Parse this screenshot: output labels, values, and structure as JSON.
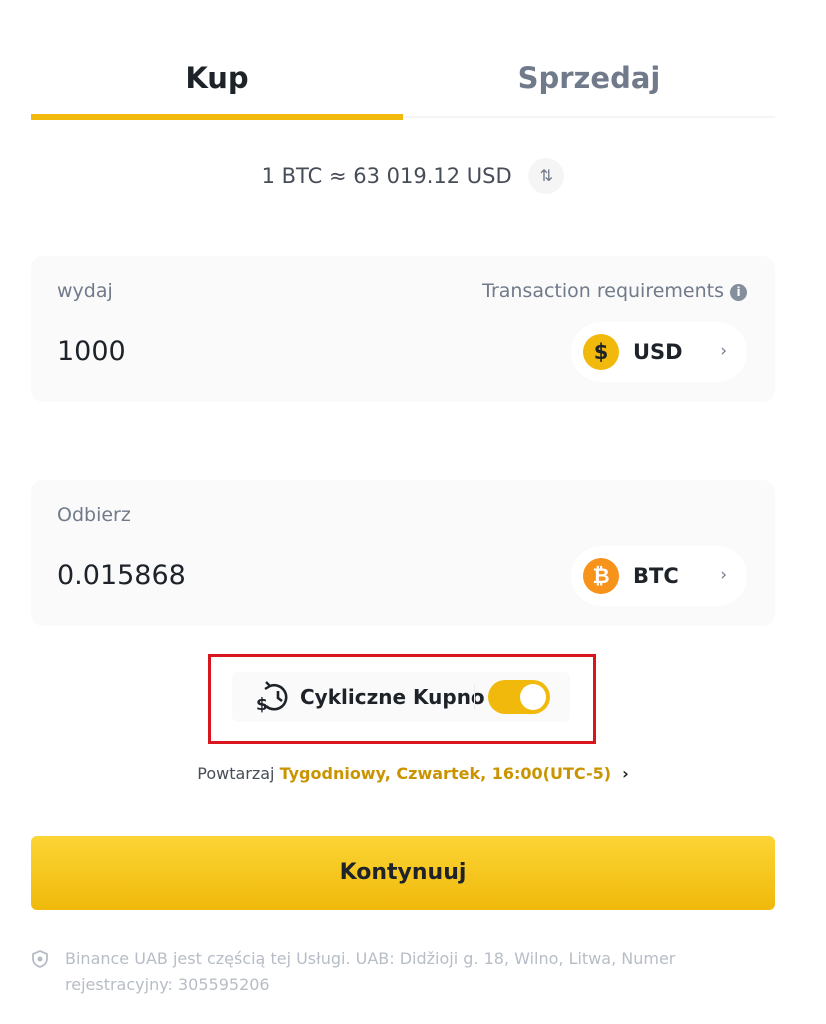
{
  "tabs": {
    "buy": "Kup",
    "sell": "Sprzedaj",
    "active": "buy"
  },
  "rate": {
    "text": "1 BTC ≈ 63 019.12 USD",
    "swap_icon": "swap-vertical-icon"
  },
  "spend": {
    "label": "wydaj",
    "requirements": "Transaction requirements",
    "amount": "1000",
    "currency": "USD",
    "currency_symbol": "$",
    "chevron": "›"
  },
  "receive": {
    "label": "Odbierz",
    "amount": "0.015868",
    "currency": "BTC",
    "currency_symbol": "₿",
    "chevron": "›"
  },
  "recurring": {
    "label": "Cykliczne Kupno",
    "enabled": true,
    "icon": "recurring-dollar-clock-icon"
  },
  "repeat": {
    "prefix": "Powtarzaj",
    "value": "Tygodniowy, Czwartek, 16:00(UTC-5)",
    "chevron": "›"
  },
  "continue_label": "Kontynuuj",
  "footer": {
    "text": "Binance UAB jest częścią tej Usługi. UAB: Didžioji g. 18, Wilno, Litwa, Numer rejestracyjny: 305595206"
  },
  "colors": {
    "brand_yellow": "#f0b90b",
    "highlight_red": "#d9161e",
    "btc_orange": "#f7931a"
  }
}
